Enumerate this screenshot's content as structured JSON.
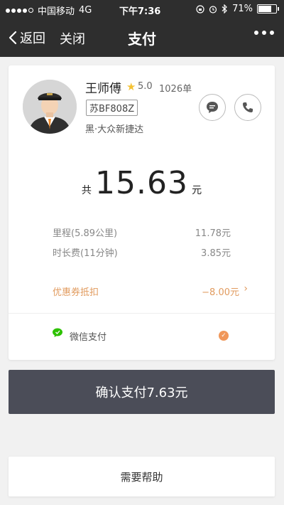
{
  "status_bar": {
    "carrier": "中国移动",
    "network": "4G",
    "time": "下午7:36",
    "battery": "71%",
    "icons": [
      "lock-rotation-icon",
      "alarm-icon",
      "bluetooth-icon",
      "battery-icon"
    ]
  },
  "nav": {
    "back_label": "返回",
    "close_label": "关闭",
    "title": "支付"
  },
  "driver": {
    "name": "王师傅",
    "rating": "5.0",
    "orders": "1026单",
    "plate": "苏BF808Z",
    "car": "黑·大众新捷达"
  },
  "fare": {
    "prefix": "共",
    "total": "15.63",
    "unit": "元",
    "items": [
      {
        "label": "里程(5.89公里)",
        "value": "11.78元"
      },
      {
        "label": "时长费(11分钟)",
        "value": "3.85元"
      }
    ],
    "discount": {
      "label": "优惠券抵扣",
      "value": "−8.00元"
    }
  },
  "payment": {
    "method": "微信支付",
    "selected": true
  },
  "buttons": {
    "confirm": "确认支付7.63元",
    "help": "需要帮助"
  },
  "colors": {
    "dark": "#2e2e2e",
    "confirm_bg": "#4b4d58",
    "accent_orange": "#e19b5f",
    "wechat_green": "#2dc100",
    "star_gold": "#f5c233"
  }
}
